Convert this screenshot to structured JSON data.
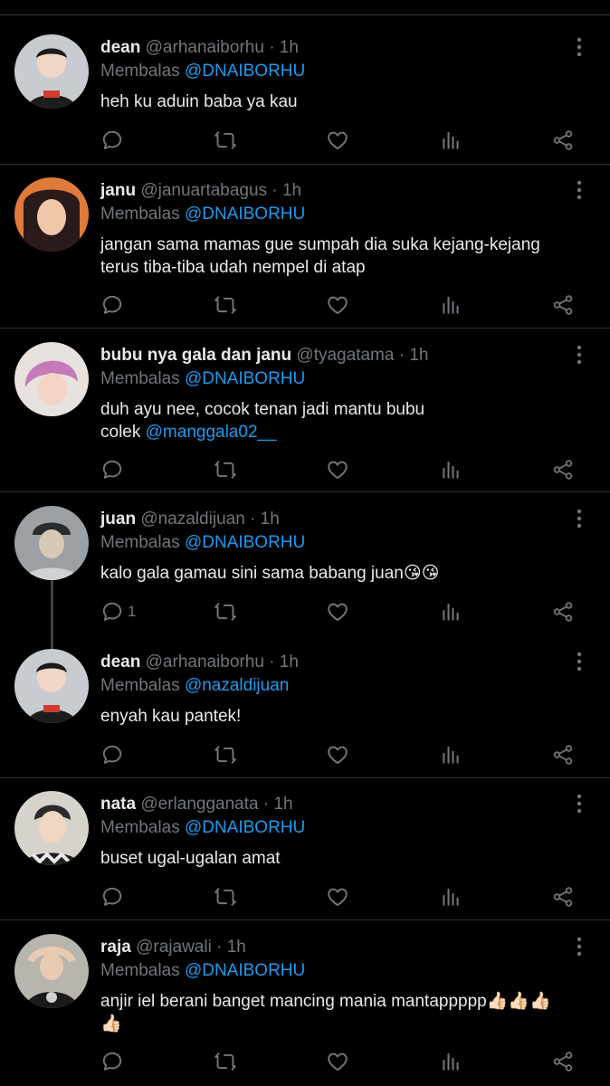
{
  "reply_prefix": "Membalas",
  "tweets": [
    {
      "name": "dean",
      "handle": "@arhanaiborhu",
      "dot": "·",
      "time": "1h",
      "reply_to": "@DNAIBORHU",
      "body_line1": "heh ku aduin baba ya kau",
      "body_line2": "",
      "reply_count": "",
      "avatar_colors": [
        "#c8ccd0",
        "#1c1c1c",
        "#d23a2e"
      ]
    },
    {
      "name": "janu",
      "handle": "@januartabagus",
      "dot": "·",
      "time": "1h",
      "reply_to": "@DNAIBORHU",
      "body_line1": "jangan sama mamas gue sumpah dia suka kejang-kejang",
      "body_line2": "terus tiba-tiba udah nempel di atap",
      "reply_count": "",
      "avatar_colors": [
        "#e07a3a",
        "#2a1a1a",
        "#f0c8a8"
      ]
    },
    {
      "name": "bubu nya gala dan janu",
      "handle": "@tyagatama",
      "dot": "·",
      "time": "1h",
      "reply_to": "@DNAIBORHU",
      "body_line1": "duh ayu nee, cocok tenan jadi mantu bubu",
      "body_line2_prefix": "colek ",
      "body_line2_mention": "@manggala02__",
      "reply_count": "",
      "avatar_colors": [
        "#e8e2de",
        "#c47ab8",
        "#f2d4c4"
      ]
    },
    {
      "name": "juan",
      "handle": "@nazaldijuan",
      "dot": "·",
      "time": "1h",
      "reply_to": "@DNAIBORHU",
      "body_line1": "kalo gala gamau sini sama babang juan😘😘",
      "body_line2": "",
      "reply_count": "1",
      "avatar_colors": [
        "#9aa0a4",
        "#2b2b2b",
        "#d8c8b8"
      ]
    },
    {
      "name": "dean",
      "handle": "@arhanaiborhu",
      "dot": "·",
      "time": "1h",
      "reply_to": "@nazaldijuan",
      "body_line1": "enyah kau pantek!",
      "body_line2": "",
      "reply_count": "",
      "avatar_colors": [
        "#c8ccd0",
        "#1c1c1c",
        "#d23a2e"
      ]
    },
    {
      "name": "nata",
      "handle": "@erlangganata",
      "dot": "·",
      "time": "1h",
      "reply_to": "@DNAIBORHU",
      "body_line1": "buset ugal-ugalan amat",
      "body_line2": "",
      "reply_count": "",
      "avatar_colors": [
        "#d6d2cc",
        "#1e1e1e",
        "#f0d6c0"
      ]
    },
    {
      "name": "raja",
      "handle": "@rajawali",
      "dot": "·",
      "time": "1h",
      "reply_to": "@DNAIBORHU",
      "body_line1": "anjir iel berani banget mancing mania mantappppp👍🏻👍🏻👍🏻",
      "body_line2": "👍🏻",
      "reply_count": "",
      "avatar_colors": [
        "#b8b4ae",
        "#1a1a1a",
        "#e8cbb2"
      ]
    }
  ],
  "icons": [
    "reply-icon",
    "retweet-icon",
    "like-icon",
    "views-icon",
    "share-icon",
    "more-icon"
  ],
  "colors": {
    "background": "#000000",
    "text": "#e7e9ea",
    "muted": "#71767b",
    "mention": "#1d9bf0",
    "separator": "#2f3336"
  }
}
